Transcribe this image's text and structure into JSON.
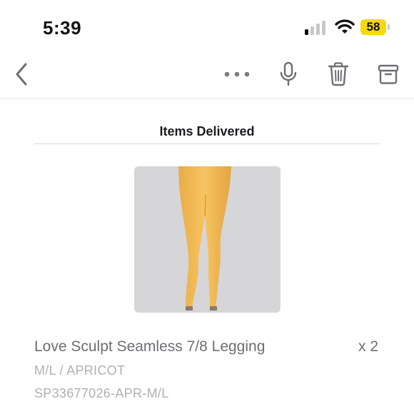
{
  "status_bar": {
    "time": "5:39",
    "battery_level": "58",
    "battery_color": "#f5d90a",
    "signal_bars_active": 1,
    "signal_bars_total": 4,
    "icons": [
      "signal-icon",
      "wifi-icon",
      "battery-icon"
    ]
  },
  "toolbar": {
    "icons": [
      "back-chevron-icon",
      "more-dots-icon",
      "microphone-icon",
      "trash-icon",
      "archive-icon"
    ]
  },
  "section": {
    "title": "Items Delivered"
  },
  "item": {
    "name": "Love Sculpt Seamless 7/8 Legging",
    "quantity": "x 2",
    "variant": "M/L / APRICOT",
    "sku": "SP33677026-APR-M/L",
    "image_color": "#f5c05a"
  }
}
